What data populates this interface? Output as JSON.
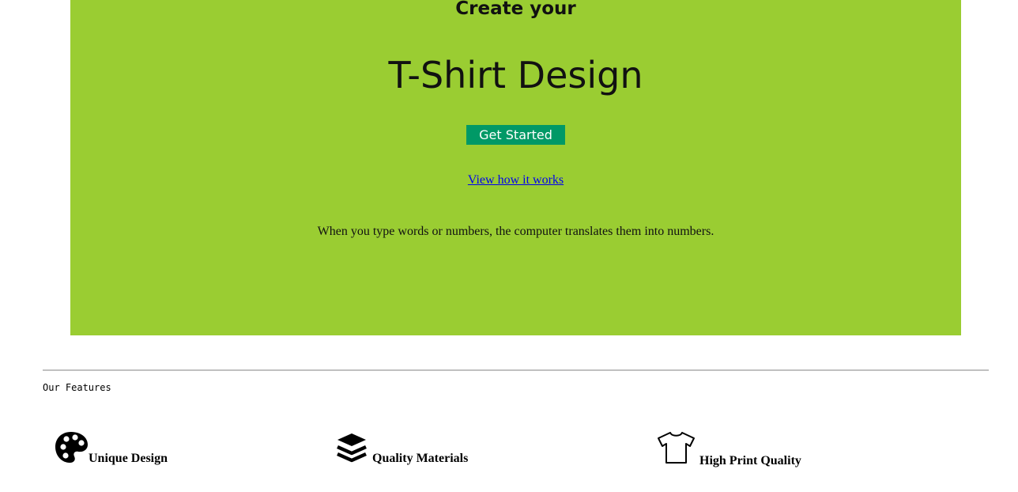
{
  "hero": {
    "subtitle": "Create your",
    "title": "T-Shirt Design",
    "button_label": "Get Started",
    "link_label": "View how it works",
    "description": "When you type words or numbers, the computer translates them into numbers.",
    "background_color": "#9acd32",
    "button_color": "#009966"
  },
  "features": {
    "heading": "Our Features",
    "items": [
      {
        "label": "Unique Design",
        "icon": "palette-icon"
      },
      {
        "label": "Quality Materials",
        "icon": "layers-icon"
      },
      {
        "label": "High Print Quality",
        "icon": "tshirt-icon"
      }
    ]
  }
}
